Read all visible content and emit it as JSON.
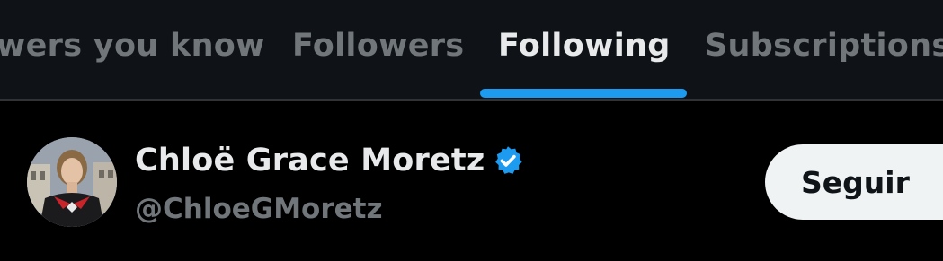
{
  "tabs": [
    {
      "label": "wers you know",
      "active": false
    },
    {
      "label": "Followers",
      "active": false
    },
    {
      "label": "Following",
      "active": true
    },
    {
      "label": "Subscriptions",
      "active": false
    }
  ],
  "user": {
    "display_name": "Chloë Grace Moretz",
    "handle": "@ChloeGMoretz",
    "verified": true,
    "avatar_icon": "profile-photo",
    "follow_label": "Seguir"
  },
  "colors": {
    "accent": "#1d9bf0",
    "background": "#000000",
    "tabbar_background": "#0f1317",
    "primary_text": "#e7e9ea",
    "secondary_text": "#71767b",
    "button_background": "#eff3f4"
  }
}
